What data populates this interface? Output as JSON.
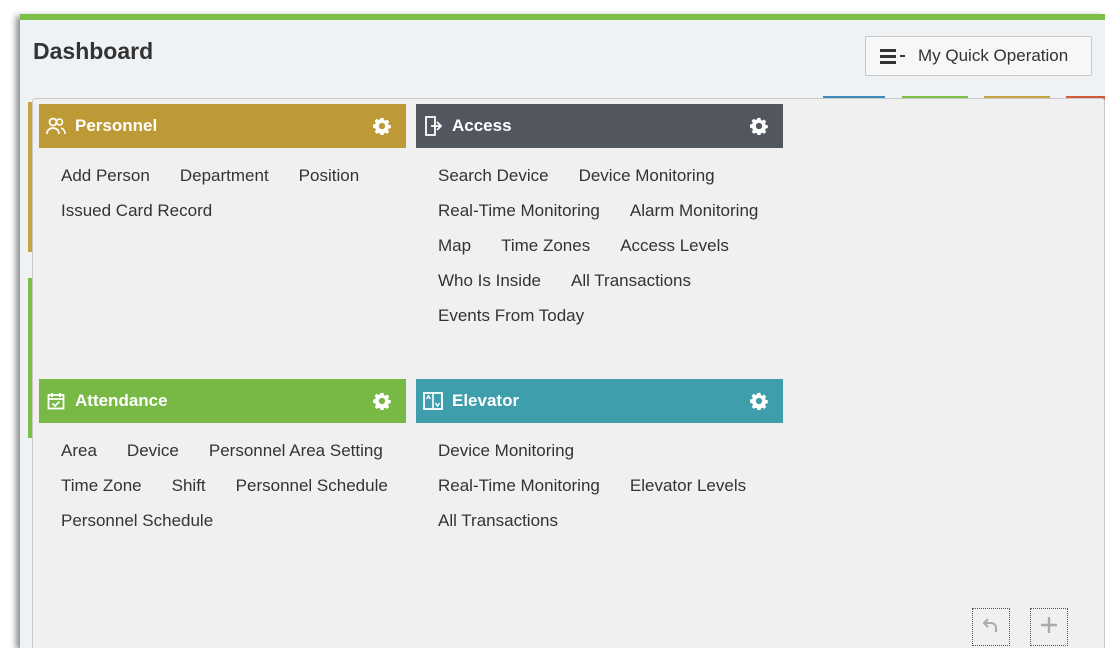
{
  "header": {
    "title": "Dashboard",
    "quick_operation_label": "My Quick Operation"
  },
  "colors": {
    "accent_green": "#7bbf44",
    "personnel": "#bd9a35",
    "access": "#52565f",
    "attendance": "#78b844",
    "elevator": "#3f9eab"
  },
  "modules": {
    "personnel": {
      "title": "Personnel",
      "icon": "people-icon",
      "rows": [
        [
          "Add Person",
          "Department",
          "Position"
        ],
        [
          "Issued Card Record"
        ]
      ]
    },
    "access": {
      "title": "Access",
      "icon": "door-exit-icon",
      "rows": [
        [
          "Search Device",
          "Device Monitoring"
        ],
        [
          "Real-Time Monitoring",
          "Alarm Monitoring"
        ],
        [
          "Map",
          "Time Zones",
          "Access Levels"
        ],
        [
          "Who Is Inside",
          "All Transactions"
        ],
        [
          "Events From Today"
        ]
      ]
    },
    "attendance": {
      "title": "Attendance",
      "icon": "calendar-check-icon",
      "rows": [
        [
          "Area",
          "Device",
          "Personnel Area Setting"
        ],
        [
          "Time Zone",
          "Shift",
          "Personnel Schedule"
        ],
        [
          "Personnel Schedule"
        ]
      ]
    },
    "elevator": {
      "title": "Elevator",
      "icon": "elevator-icon",
      "rows": [
        [
          "Device Monitoring"
        ],
        [
          "Real-Time Monitoring",
          "Elevator Levels"
        ],
        [
          "All Transactions"
        ]
      ]
    }
  },
  "corner_controls": {
    "undo_icon": "undo-arrow-icon",
    "add_icon": "plus-icon"
  }
}
